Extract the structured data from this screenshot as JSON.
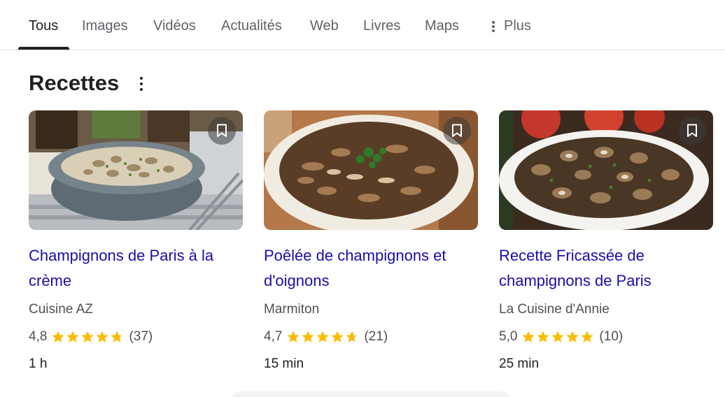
{
  "tabs": {
    "items": [
      {
        "label": "Tous"
      },
      {
        "label": "Images"
      },
      {
        "label": "Vidéos"
      },
      {
        "label": "Actualités"
      },
      {
        "label": "Web"
      },
      {
        "label": "Livres"
      },
      {
        "label": "Maps"
      }
    ],
    "active_index": 0,
    "more_label": "Plus"
  },
  "section": {
    "title": "Recettes"
  },
  "recipes": [
    {
      "title": "Champignons de Paris à la crème",
      "source": "Cuisine AZ",
      "rating": "4,8",
      "rating_value": 4.8,
      "reviews": "(37)",
      "time": "1 h"
    },
    {
      "title": "Poêlée de champignons et d'oignons",
      "source": "Marmiton",
      "rating": "4,7",
      "rating_value": 4.7,
      "reviews": "(21)",
      "time": "15 min"
    },
    {
      "title": "Recette Fricassée de champignons de Paris",
      "source": "La Cuisine d'Annie",
      "rating": "5,0",
      "rating_value": 5.0,
      "reviews": "(10)",
      "time": "25 min"
    }
  ],
  "colors": {
    "link": "#1a0dab",
    "star": "#fbbc04",
    "star_empty": "#dadce0",
    "text_secondary": "#4d5156"
  },
  "icons": {
    "more": "vertical-dots-icon",
    "bookmark": "bookmark-icon",
    "star": "star-icon"
  }
}
